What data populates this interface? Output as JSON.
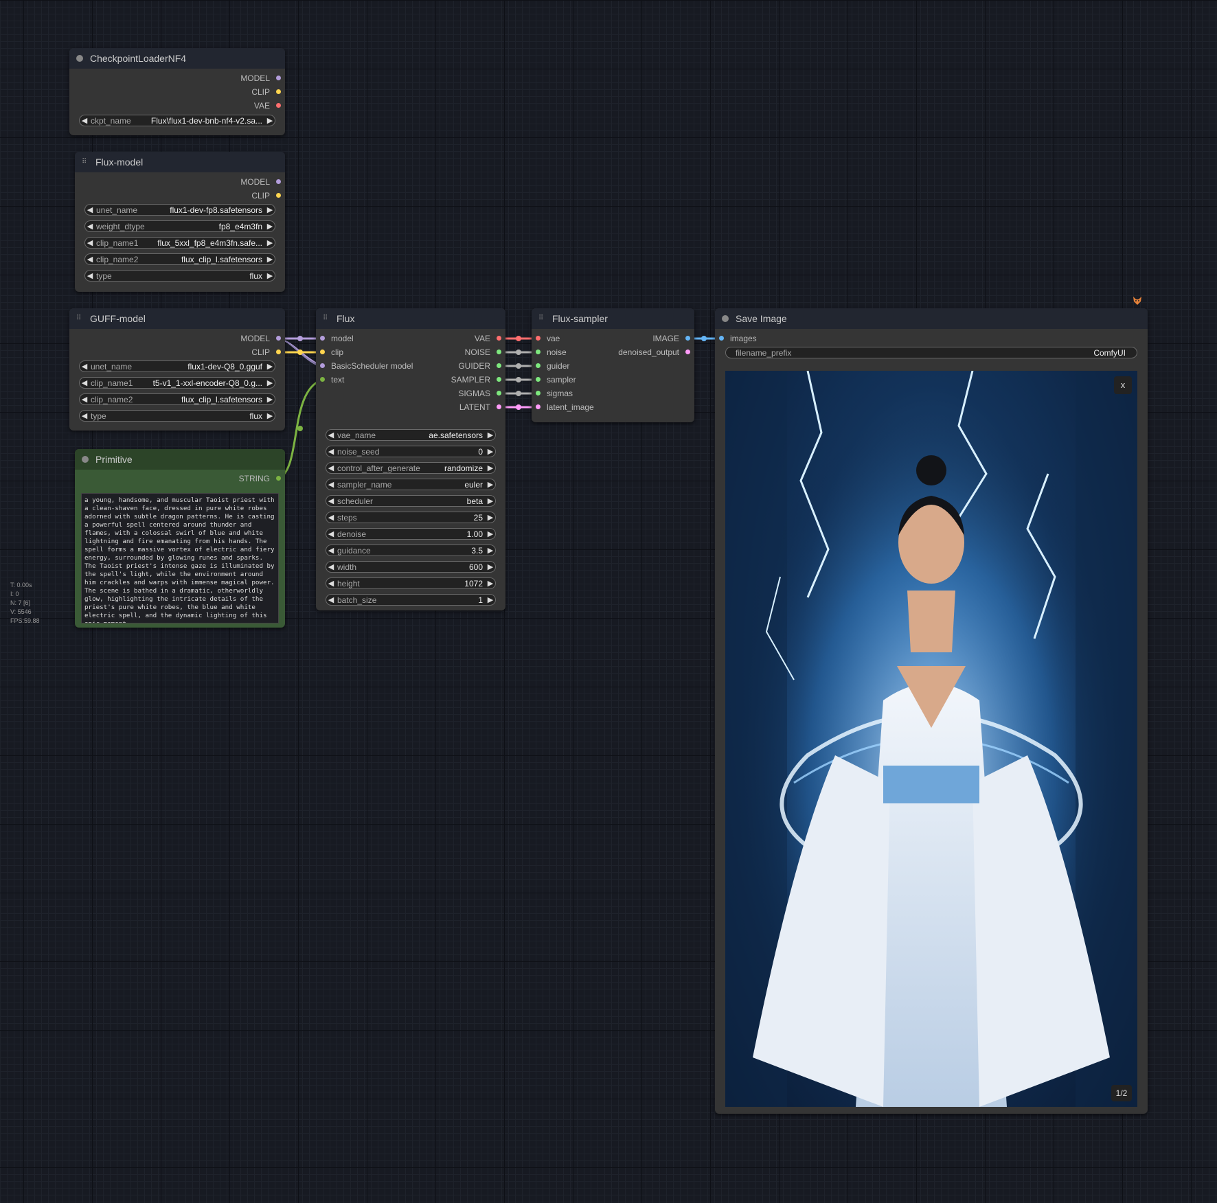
{
  "colors": {
    "canvas": "#171a22",
    "node_bg": "#353535",
    "node_title": "#222630",
    "primitive_bg": "#3a5a36",
    "primitive_title": "#2c4428",
    "model": "#b39ddb",
    "clip": "#ffd54f",
    "vae": "#ff6e6e",
    "noise_guider": "#b0b0b0",
    "latent": "#ff9cf9",
    "image": "#64b5f6",
    "string": "#7cb342",
    "green_slot": "#7ee87e"
  },
  "checkpoint_loader": {
    "title": "CheckpointLoaderNF4",
    "outputs": [
      "MODEL",
      "CLIP",
      "VAE"
    ],
    "ckpt_label": "ckpt_name",
    "ckpt_value": "Flux\\flux1-dev-bnb-nf4-v2.sa..."
  },
  "flux_model": {
    "title": "Flux-model",
    "outputs": [
      "MODEL",
      "CLIP"
    ],
    "widgets": [
      {
        "label": "unet_name",
        "value": "flux1-dev-fp8.safetensors"
      },
      {
        "label": "weight_dtype",
        "value": "fp8_e4m3fn"
      },
      {
        "label": "clip_name1",
        "value": "flux_5xxl_fp8_e4m3fn.safe..."
      },
      {
        "label": "clip_name2",
        "value": "flux_clip_l.safetensors"
      },
      {
        "label": "type",
        "value": "flux"
      }
    ]
  },
  "guff_model": {
    "title": "GUFF-model",
    "outputs": [
      "MODEL",
      "CLIP"
    ],
    "widgets": [
      {
        "label": "unet_name",
        "value": "flux1-dev-Q8_0.gguf"
      },
      {
        "label": "clip_name1",
        "value": "t5-v1_1-xxl-encoder-Q8_0.g..."
      },
      {
        "label": "clip_name2",
        "value": "flux_clip_l.safetensors"
      },
      {
        "label": "type",
        "value": "flux"
      }
    ]
  },
  "primitive": {
    "title": "Primitive",
    "output": "STRING",
    "text": "a young, handsome, and muscular Taoist priest with a clean-shaven face, dressed in pure white robes adorned with subtle dragon patterns. He is casting a powerful spell centered around thunder and flames, with a colossal swirl of blue and white lightning and fire emanating from his hands. The spell forms a massive vortex of electric and fiery energy, surrounded by glowing runes and sparks. The Taoist priest's intense gaze is illuminated by the spell's light, while the environment around him crackles and warps with immense magical power. The scene is bathed in a dramatic, otherworldly glow, highlighting the intricate details of the priest's pure white robes, the blue and white electric spell, and the dynamic lighting of this epic moment."
  },
  "flux": {
    "title": "Flux",
    "inputs": [
      "model",
      "clip",
      "BasicScheduler model",
      "text"
    ],
    "outputs": [
      "VAE",
      "NOISE",
      "GUIDER",
      "SAMPLER",
      "SIGMAS",
      "LATENT"
    ],
    "widgets": [
      {
        "label": "vae_name",
        "value": "ae.safetensors"
      },
      {
        "label": "noise_seed",
        "value": "0"
      },
      {
        "label": "control_after_generate",
        "value": "randomize"
      },
      {
        "label": "sampler_name",
        "value": "euler"
      },
      {
        "label": "scheduler",
        "value": "beta"
      },
      {
        "label": "steps",
        "value": "25"
      },
      {
        "label": "denoise",
        "value": "1.00"
      },
      {
        "label": "guidance",
        "value": "3.5"
      },
      {
        "label": "width",
        "value": "600"
      },
      {
        "label": "height",
        "value": "1072"
      },
      {
        "label": "batch_size",
        "value": "1"
      }
    ]
  },
  "flux_sampler": {
    "title": "Flux-sampler",
    "inputs": [
      "vae",
      "noise",
      "guider",
      "sampler",
      "sigmas",
      "latent_image"
    ],
    "outputs": [
      "IMAGE",
      "denoised_output"
    ]
  },
  "save_image": {
    "title": "Save Image",
    "input": "images",
    "prefix_label": "filename_prefix",
    "prefix_value": "ComfyUI",
    "close_label": "x",
    "page_indicator": "1/2"
  },
  "stats": {
    "t": "T: 0.00s",
    "i": "I: 0",
    "n": "N: 7 [6]",
    "v": "V: 5546",
    "fps": "FPS:59.88"
  }
}
